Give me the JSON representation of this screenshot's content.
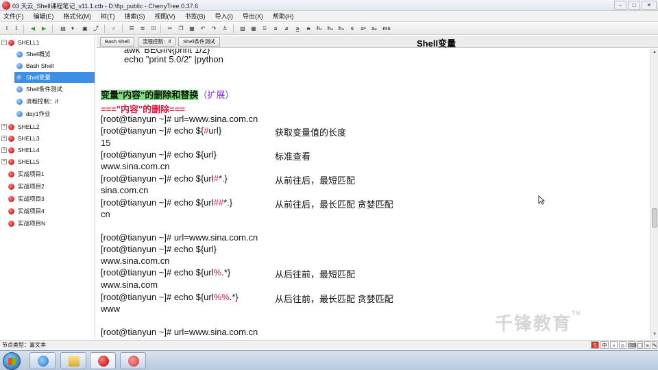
{
  "window": {
    "title": "03 天云_Shell课程笔记_v11.1.ctb - D:\\ftp_public - CherryTree 0.37.6",
    "buttons": {
      "minimize": "–",
      "maximize": "□",
      "close": "✕"
    }
  },
  "menu": [
    "文件(F)",
    "编辑(E)",
    "格式化(M)",
    "树(T)",
    "搜索(S)",
    "视图(V)",
    "书签(B)",
    "导入(I)",
    "导出(X)",
    "帮助(H)"
  ],
  "toolbar": {
    "icons": [
      "tree-up-icon",
      "tree-down-icon",
      "back-arrow-icon",
      "forward-arrow-icon",
      "print-icon",
      "save-icon",
      "export-icon",
      "find-icon",
      "bullet-list-icon",
      "numbered-list-icon",
      "todo-list-icon",
      "cut-icon",
      "copy-icon",
      "paste-icon",
      "undo-icon",
      "link-icon",
      "image-icon",
      "table-icon",
      "codebox-icon"
    ],
    "format_labels": [
      "a",
      "a",
      "a",
      "a",
      "h₁",
      "h₂",
      "h₃",
      "s",
      "aˢ",
      "aₛ",
      "ms"
    ]
  },
  "sidebar": {
    "items": [
      {
        "label": "SHELL1",
        "level": 0,
        "expander": "-",
        "color": "red"
      },
      {
        "label": "Shell概览",
        "level": 1,
        "color": "blue"
      },
      {
        "label": "Bash Shell",
        "level": 1,
        "color": "blue"
      },
      {
        "label": "Shell变量",
        "level": 1,
        "color": "blue",
        "selected": true
      },
      {
        "label": "Shell条件测试",
        "level": 1,
        "color": "blue"
      },
      {
        "label": "流程控制：if",
        "level": 1,
        "color": "blue"
      },
      {
        "label": "day1作业",
        "level": 1,
        "color": "blue"
      },
      {
        "label": "SHELL2",
        "level": 0,
        "expander": "+",
        "color": "red"
      },
      {
        "label": "SHELL3",
        "level": 0,
        "expander": "+",
        "color": "red"
      },
      {
        "label": "SHELL4",
        "level": 0,
        "expander": "+",
        "color": "red"
      },
      {
        "label": "SHELL5",
        "level": 0,
        "expander": "+",
        "color": "red"
      },
      {
        "label": "实战项目1",
        "level": 0,
        "color": "red"
      },
      {
        "label": "实战项目2",
        "level": 0,
        "color": "red"
      },
      {
        "label": "实战项目3",
        "level": 0,
        "color": "red"
      },
      {
        "label": "实战项目4",
        "level": 0,
        "color": "red"
      },
      {
        "label": "实战项目N",
        "level": 0,
        "color": "red"
      }
    ]
  },
  "tabs": [
    "Bash Shell",
    "流程控制：if",
    "Shell条件测试"
  ],
  "node_title": "Shell变量",
  "content": {
    "top_partial": "awk 'BEGIN{print 1/2}'",
    "python_line": "echo \"print 5.0/2\" |python",
    "section_heading": "变量\"内容\"的删除和替换",
    "section_heading_suffix": "（扩展）",
    "sub_heading": "===\"内容\"的删除===",
    "prompt": "[root@tianyun ~]#",
    "lines": {
      "set_url_1": "url=www.sina.com.cn",
      "len_cmd_pre": "echo ${",
      "len_op": "#",
      "len_cmd_post": "url}",
      "len_comment": "获取变量值的长度",
      "len_out": "15",
      "plain_cmd": "echo ${url}",
      "plain_comment": "标准查看",
      "plain_out": "www.sina.com.cn",
      "short_front_pre": "echo ${url",
      "short_front_op": "#",
      "short_front_post": "*.}",
      "short_front_comment": "从前往后，最短匹配",
      "short_front_out": "sina.com.cn",
      "long_front_pre": "echo ${url",
      "long_front_op": "##",
      "long_front_post": "*.}",
      "long_front_comment": "从前往后，最长匹配  贪婪匹配",
      "long_front_out": "cn",
      "set_url_2": "url=www.sina.com.cn",
      "plain_cmd_2": "echo ${url}",
      "plain_out_2": "www.sina.com.cn",
      "short_back_pre": "echo ${url",
      "short_back_op": "%",
      "short_back_post": ".*}",
      "short_back_comment": "从后往前，最短匹配",
      "short_back_out": "www.sina.com",
      "long_back_pre": "echo ${url",
      "long_back_op": "%%",
      "long_back_post": ".*}",
      "long_back_comment": "从后往前，最长匹配  贪婪匹配",
      "long_back_out": "www",
      "set_url_3": "url=www.sina.com.cn"
    }
  },
  "watermark": {
    "text": "千锋教育",
    "tm": "TM"
  },
  "status": {
    "node_type": "节点类型：富文本",
    "ime": [
      "中",
      "∘",
      "☺",
      "⌨",
      "☐",
      "≡",
      "✎"
    ]
  },
  "taskbar": {
    "apps": [
      "start-orb",
      "ie-icon",
      "file-explorer-icon",
      "cherrytree-icon",
      "app-icon"
    ]
  },
  "colors": {
    "selected_bg": "#3d8ee6",
    "heading_highlight": "#7fe07f",
    "accent_purple": "#8a2be2",
    "accent_red": "#e0163c"
  }
}
